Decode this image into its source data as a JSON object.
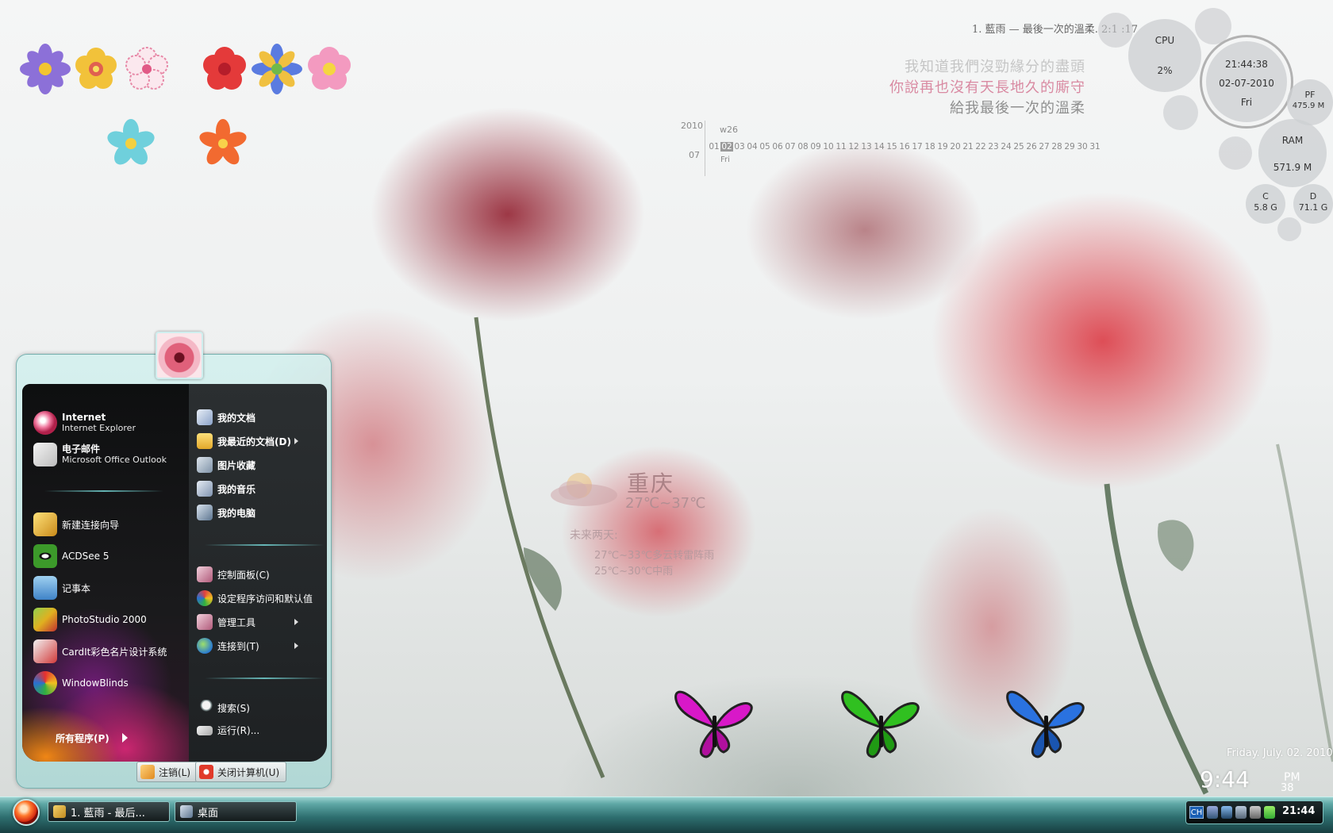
{
  "desktop": {
    "now_playing": "1. 藍雨 — 最後一次的溫柔. 2:1   :17",
    "lyrics": [
      "我知道我們沒勁緣分的盡頭",
      "你說再也沒有天長地久的廝守",
      "給我最後一次的溫柔"
    ],
    "calendar": {
      "year": "2010",
      "month": "07",
      "week": "w26",
      "weekday": "Fri",
      "days": [
        "01",
        "02",
        "03",
        "04",
        "05",
        "06",
        "07",
        "08",
        "09",
        "10",
        "11",
        "12",
        "13",
        "14",
        "15",
        "16",
        "17",
        "18",
        "19",
        "20",
        "21",
        "22",
        "23",
        "24",
        "25",
        "26",
        "27",
        "28",
        "29",
        "30",
        "31"
      ],
      "today": "02"
    },
    "system": {
      "cpu_label": "CPU",
      "cpu_value": "2%",
      "clock_time": "21:44:38",
      "clock_date": "02-07-2010",
      "clock_day": "Fri",
      "pf_label": "PF",
      "pf_value": "475.9 M",
      "ram_label": "RAM",
      "ram_value": "571.9 M",
      "c_label": "C",
      "c_value": "5.8 G",
      "d_label": "D",
      "d_value": "71.1 G"
    },
    "weather": {
      "city": "重庆",
      "today": "27℃~37℃",
      "next_label": "未来两天:",
      "forecast": [
        "27℃~33℃多云转雷阵雨",
        "25℃~30℃中雨"
      ]
    },
    "big_date": "Friday. July. 02. 2010",
    "big_time": "9:44",
    "big_ampm": "PM",
    "big_seconds": "38"
  },
  "start_menu": {
    "pinned": [
      {
        "title": "Internet",
        "subtitle": "Internet Explorer"
      },
      {
        "title": "电子邮件",
        "subtitle": "Microsoft Office Outlook"
      }
    ],
    "recent": [
      "新建连接向导",
      "ACDSee 5",
      "记事本",
      "PhotoStudio 2000",
      "CardIt彩色名片设计系统",
      "WindowBlinds"
    ],
    "all_programs": "所有程序(P)",
    "right_places": [
      "我的文档",
      "我最近的文档(D)",
      "图片收藏",
      "我的音乐",
      "我的电脑"
    ],
    "right_settings": [
      "控制面板(C)",
      "设定程序访问和默认值",
      "管理工具",
      "连接到(T)"
    ],
    "right_actions": [
      "搜索(S)",
      "运行(R)..."
    ],
    "logoff": "注销(L)",
    "shutdown": "关闭计算机(U)"
  },
  "taskbar": {
    "tasks": [
      "1. 藍雨 - 最后...",
      "桌面"
    ],
    "lang": "CH",
    "time": "21:44"
  },
  "colors": {
    "accent_teal": "#5fa8a6",
    "menu_dark": "#141617",
    "lyric_pink": "#d98aa2"
  }
}
